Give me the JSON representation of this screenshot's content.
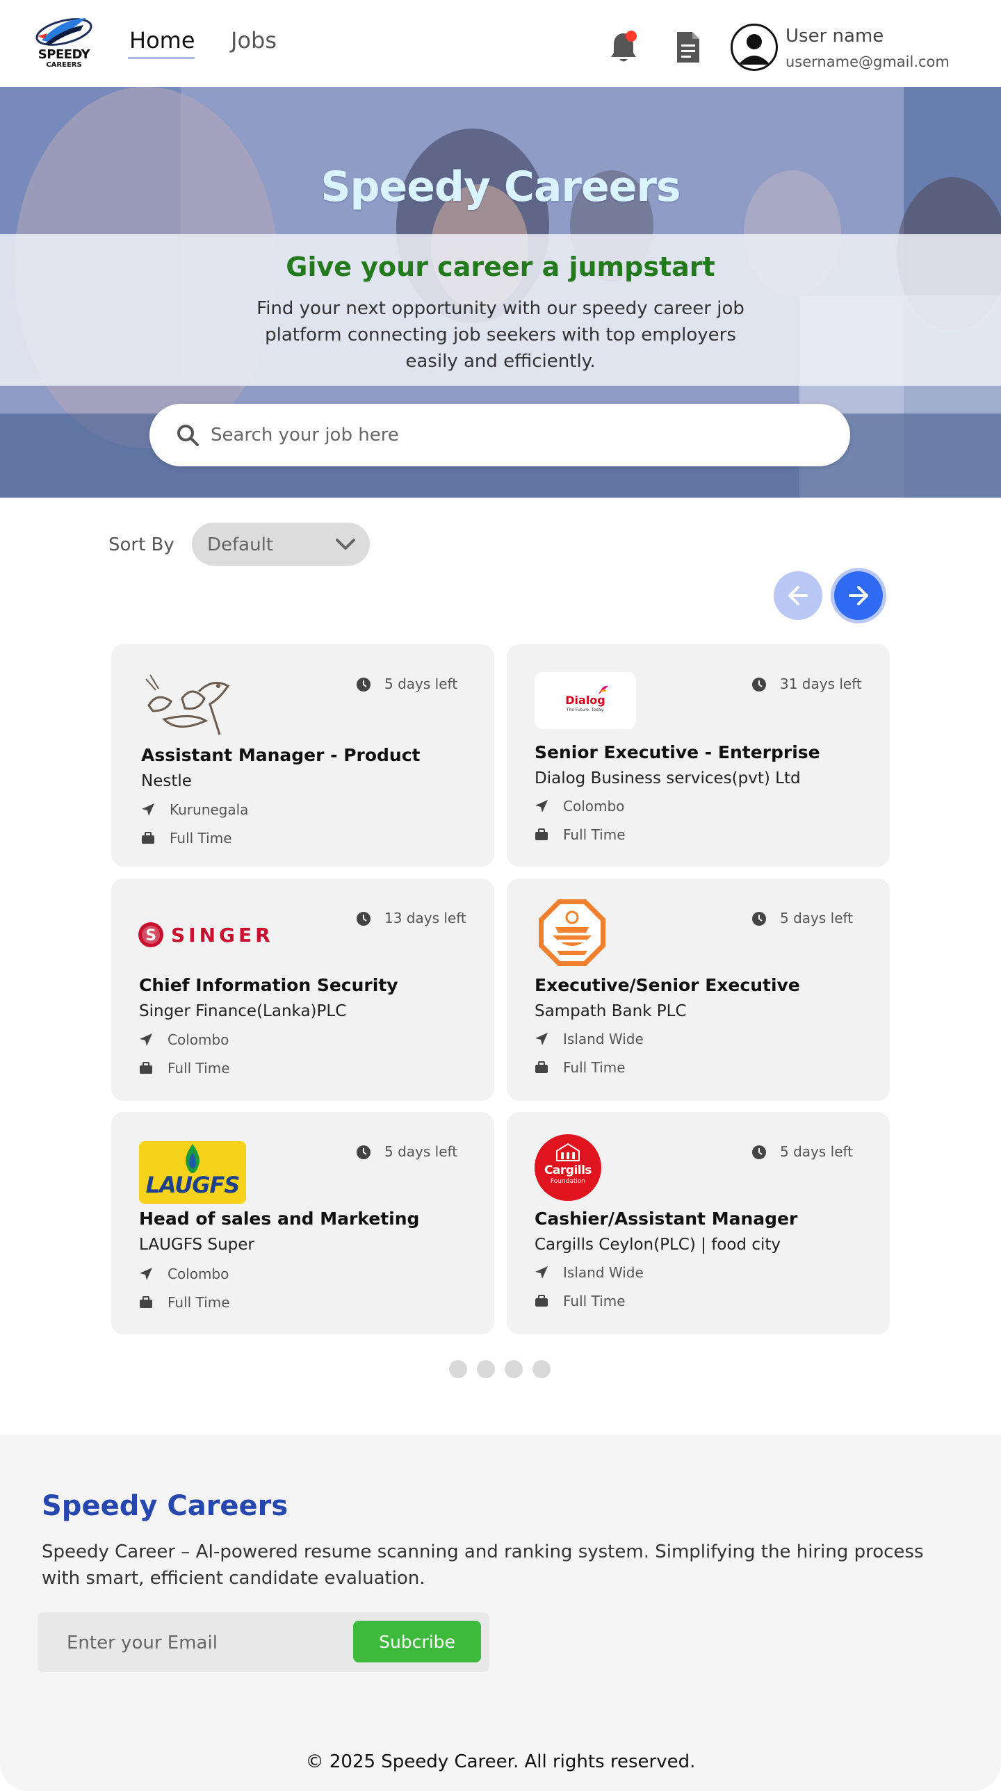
{
  "nav": {
    "logo_text": "SPEEDY",
    "logo_sub": "CAREERS",
    "links": [
      {
        "label": "Home",
        "active": true
      },
      {
        "label": "Jobs",
        "active": false
      }
    ],
    "user": {
      "name": "User name",
      "email": "username@gmail.com"
    },
    "icons": [
      "bell-icon",
      "document-icon",
      "user-avatar-icon"
    ]
  },
  "hero": {
    "title": "Speedy Careers",
    "subtitle": "Give your career a jumpstart",
    "description": "Find your next opportunity with our speedy career job platform connecting job seekers with top employers easily and efficiently.",
    "search_placeholder": "Search your job here"
  },
  "sort": {
    "label": "Sort By",
    "value": "Default"
  },
  "jobs": [
    {
      "days_left": "5 days left",
      "title": "Assistant Manager - Product",
      "company": "Nestle",
      "location": "Kurunegala",
      "type": "Full Time",
      "logo": "nestle-logo"
    },
    {
      "days_left": "31 days left",
      "title": "Senior Executive - Enterprise",
      "company": "Dialog Business services(pvt) Ltd",
      "location": "Colombo",
      "type": "Full Time",
      "logo": "dialog-logo",
      "logo_text": "Dialog",
      "logo_tagline": "The Future. Today."
    },
    {
      "days_left": "13 days left",
      "title": "Chief Information Security",
      "company": "Singer Finance(Lanka)PLC",
      "location": "Colombo",
      "type": "Full Time",
      "logo": "singer-logo",
      "logo_text": "SINGER"
    },
    {
      "days_left": "5 days left",
      "title": "Executive/Senior Executive",
      "company": "Sampath Bank PLC",
      "location": "Island Wide",
      "type": "Full Time",
      "logo": "sampath-logo"
    },
    {
      "days_left": "5 days left",
      "title": "Head of sales and Marketing",
      "company": "LAUGFS Super",
      "location": "Colombo",
      "type": "Full Time",
      "logo": "laugfs-logo",
      "logo_text": "LAUGFS"
    },
    {
      "days_left": "5 days left",
      "title": "Cashier/Assistant Manager",
      "company": "Cargills Ceylon(PLC) | food city",
      "location": "Island Wide",
      "type": "Full Time",
      "logo": "cargills-logo",
      "logo_text": "Cargills",
      "logo_tagline": "Foundation"
    }
  ],
  "pagination": {
    "pages": 4
  },
  "footer": {
    "title": "Speedy Careers",
    "description": "Speedy Career – AI-powered resume scanning and ranking system. Simplifying the hiring process with smart, efficient candidate evaluation.",
    "email_placeholder": "Enter your Email",
    "subscribe_label": "Subcribe",
    "copyright": "© 2025 Speedy Career. All rights reserved."
  },
  "colors": {
    "accent_blue": "#2f6bf2",
    "footer_title": "#2647ad",
    "hero_subtitle": "#237a1d",
    "subscribe_green": "#3dba3b",
    "notification": "#ff3b30"
  }
}
